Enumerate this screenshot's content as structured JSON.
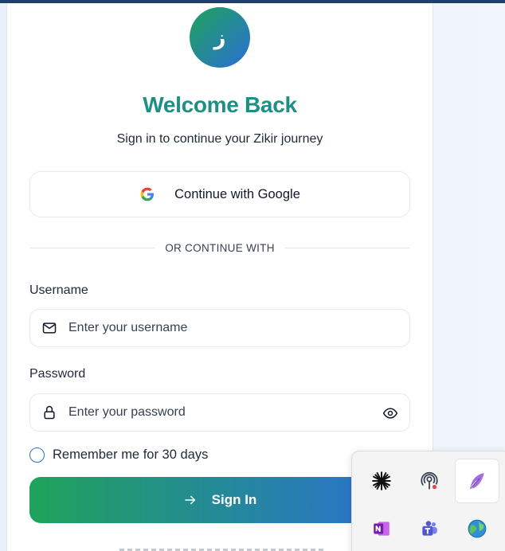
{
  "logo": {
    "glyph": "ز",
    "gradient_start": "#1fa35a",
    "gradient_end": "#2a6fd6"
  },
  "header": {
    "title": "Welcome Back",
    "subtitle": "Sign in to continue your Zikir journey"
  },
  "google_button": {
    "label": "Continue with Google",
    "icon": "google-icon"
  },
  "divider": {
    "text": "OR CONTINUE WITH"
  },
  "username": {
    "label": "Username",
    "placeholder": "Enter your username",
    "value": "",
    "icon": "mail-icon"
  },
  "password": {
    "label": "Password",
    "placeholder": "Enter your password",
    "value": "",
    "icon": "lock-icon",
    "toggle_icon": "eye-icon"
  },
  "remember": {
    "label": "Remember me for 30 days",
    "checked": false
  },
  "signin_button": {
    "label": "Sign In",
    "icon": "arrow-right-icon"
  },
  "tray": {
    "icons": [
      "sparkle-app-icon",
      "podcast-app-icon",
      "feather-app-icon",
      "onenote-icon",
      "teams-icon",
      "globe-app-icon"
    ]
  },
  "colors": {
    "title": "#1d8f84",
    "accent": "#2a6fd6",
    "green": "#1fa35a"
  }
}
